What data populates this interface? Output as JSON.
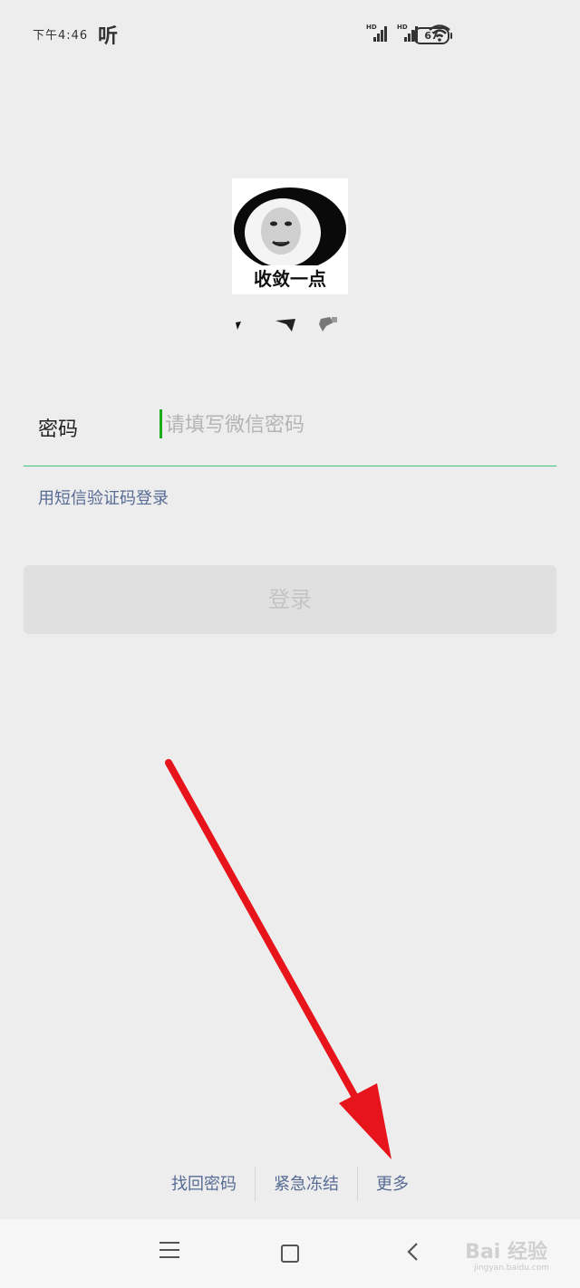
{
  "status_bar": {
    "time": "下午4:46",
    "ting": "听",
    "battery": "67",
    "signal_label": "HD"
  },
  "avatar": {
    "caption": "收敛一点"
  },
  "login": {
    "password_label": "密码",
    "password_placeholder": "请填写微信密码",
    "sms_link": "用短信验证码登录",
    "login_button": "登录"
  },
  "footer_links": [
    "找回密码",
    "紧急冻结",
    "更多"
  ],
  "watermark": {
    "text": "Bai 经验",
    "sub": "jingyan.baidu.com"
  },
  "colors": {
    "accent_green": "#1aad19",
    "link_blue": "#576b95",
    "arrow_red": "#e8141b"
  }
}
